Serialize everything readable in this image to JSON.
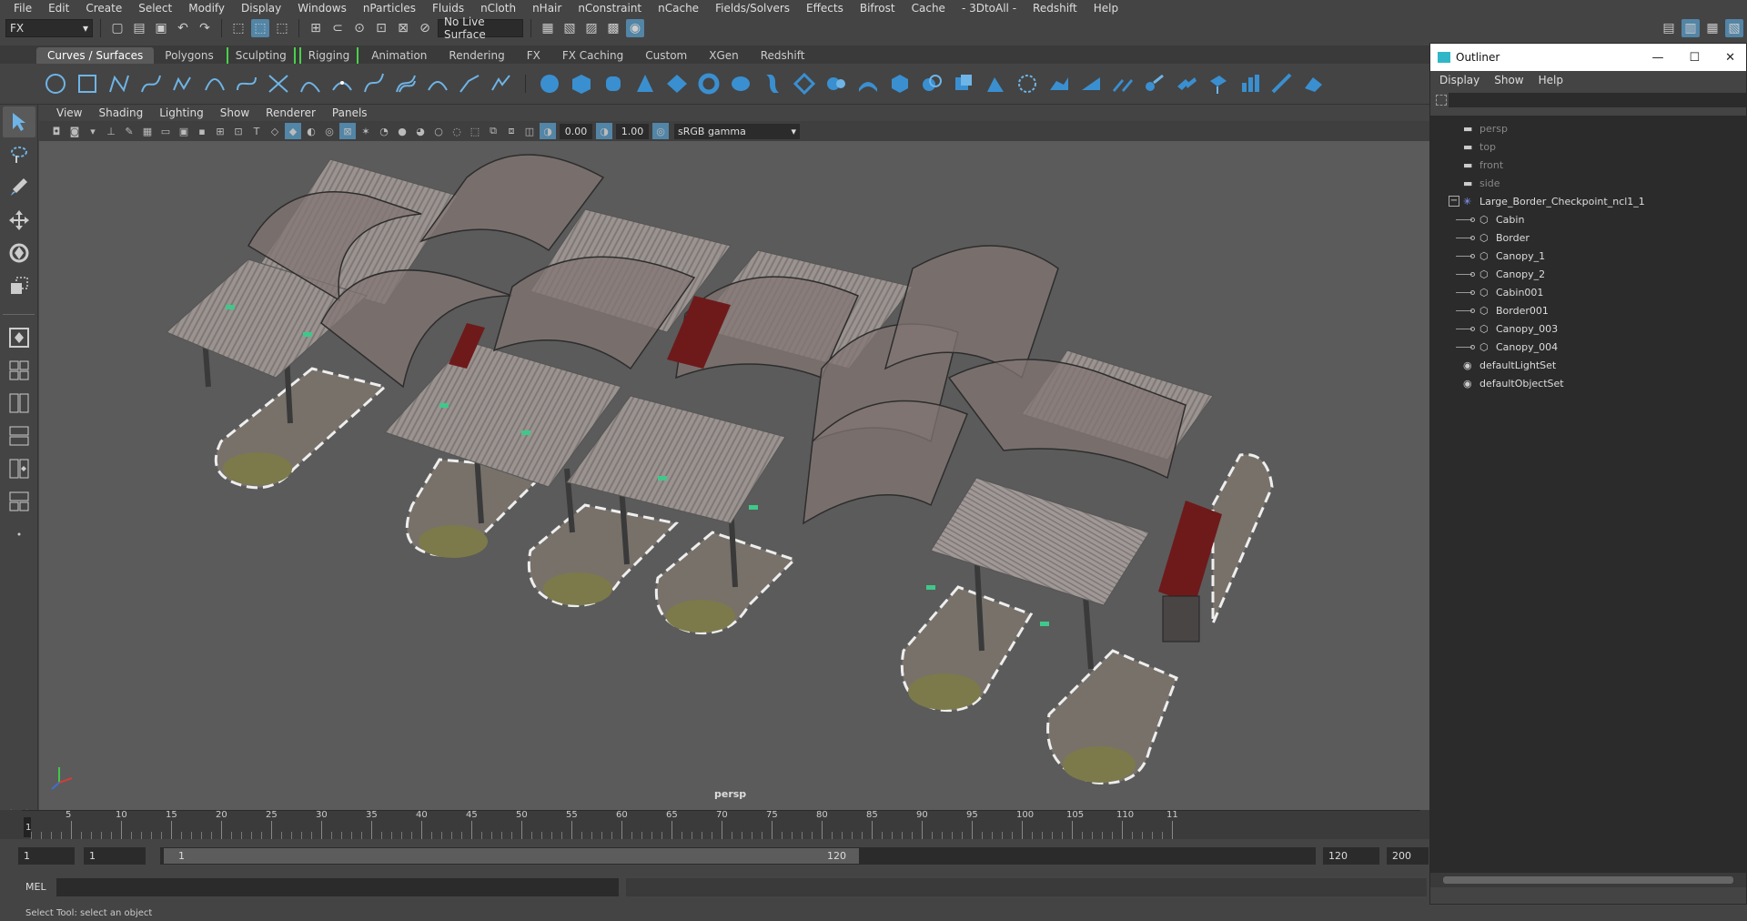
{
  "menubar": [
    "File",
    "Edit",
    "Create",
    "Select",
    "Modify",
    "Display",
    "Windows",
    "nParticles",
    "Fluids",
    "nCloth",
    "nHair",
    "nConstraint",
    "nCache",
    "Fields/Solvers",
    "Effects",
    "Bifrost",
    "Cache",
    "- 3DtoAll -",
    "Redshift",
    "Help"
  ],
  "status": {
    "mode": "FX",
    "live_surface": "No Live Surface"
  },
  "shelf_tabs": [
    "Curves / Surfaces",
    "Polygons",
    "Sculpting",
    "Rigging",
    "Animation",
    "Rendering",
    "FX",
    "FX Caching",
    "Custom",
    "XGen",
    "Redshift"
  ],
  "shelf_active": "Curves / Surfaces",
  "viewport": {
    "menu": [
      "View",
      "Shading",
      "Lighting",
      "Show",
      "Renderer",
      "Panels"
    ],
    "exposure": "0.00",
    "gamma": "1.00",
    "colorspace": "sRGB gamma",
    "camera": "persp"
  },
  "timeline": {
    "ticks": [
      "5",
      "10",
      "15",
      "20",
      "25",
      "30",
      "35",
      "40",
      "45",
      "50",
      "55",
      "60",
      "65",
      "70",
      "75",
      "80",
      "85",
      "90",
      "95",
      "100",
      "105",
      "110",
      "11"
    ],
    "current": "1"
  },
  "range": {
    "start": "1",
    "start_inner": "1",
    "slider_start": "1",
    "slider_end": "120",
    "end_inner": "120",
    "end": "200"
  },
  "cmdline": {
    "lang": "MEL"
  },
  "helpline": "Select Tool: select an object",
  "outliner": {
    "title": "Outliner",
    "menu": [
      "Display",
      "Show",
      "Help"
    ],
    "items": [
      {
        "label": "persp",
        "type": "camera",
        "dim": true,
        "indent": 0
      },
      {
        "label": "top",
        "type": "camera",
        "dim": true,
        "indent": 0
      },
      {
        "label": "front",
        "type": "camera",
        "dim": true,
        "indent": 0
      },
      {
        "label": "side",
        "type": "camera",
        "dim": true,
        "indent": 0
      },
      {
        "label": "Large_Border_Checkpoint_ncl1_1",
        "type": "group",
        "dim": false,
        "indent": 0
      },
      {
        "label": "Cabin",
        "type": "mesh",
        "dim": false,
        "indent": 1
      },
      {
        "label": "Border",
        "type": "mesh",
        "dim": false,
        "indent": 1
      },
      {
        "label": "Canopy_1",
        "type": "mesh",
        "dim": false,
        "indent": 1
      },
      {
        "label": "Canopy_2",
        "type": "mesh",
        "dim": false,
        "indent": 1
      },
      {
        "label": "Cabin001",
        "type": "mesh",
        "dim": false,
        "indent": 1
      },
      {
        "label": "Border001",
        "type": "mesh",
        "dim": false,
        "indent": 1
      },
      {
        "label": "Canopy_003",
        "type": "mesh",
        "dim": false,
        "indent": 1
      },
      {
        "label": "Canopy_004",
        "type": "mesh",
        "dim": false,
        "indent": 1
      },
      {
        "label": "defaultLightSet",
        "type": "set",
        "dim": false,
        "indent": 0
      },
      {
        "label": "defaultObjectSet",
        "type": "set",
        "dim": false,
        "indent": 0
      }
    ]
  },
  "colors": {
    "accent": "#5285a6",
    "bracket": "#4ad04a",
    "viewport_bg": "#5b5b5b",
    "roof": "#9a9290",
    "cabin_red": "#6e1a1a"
  }
}
